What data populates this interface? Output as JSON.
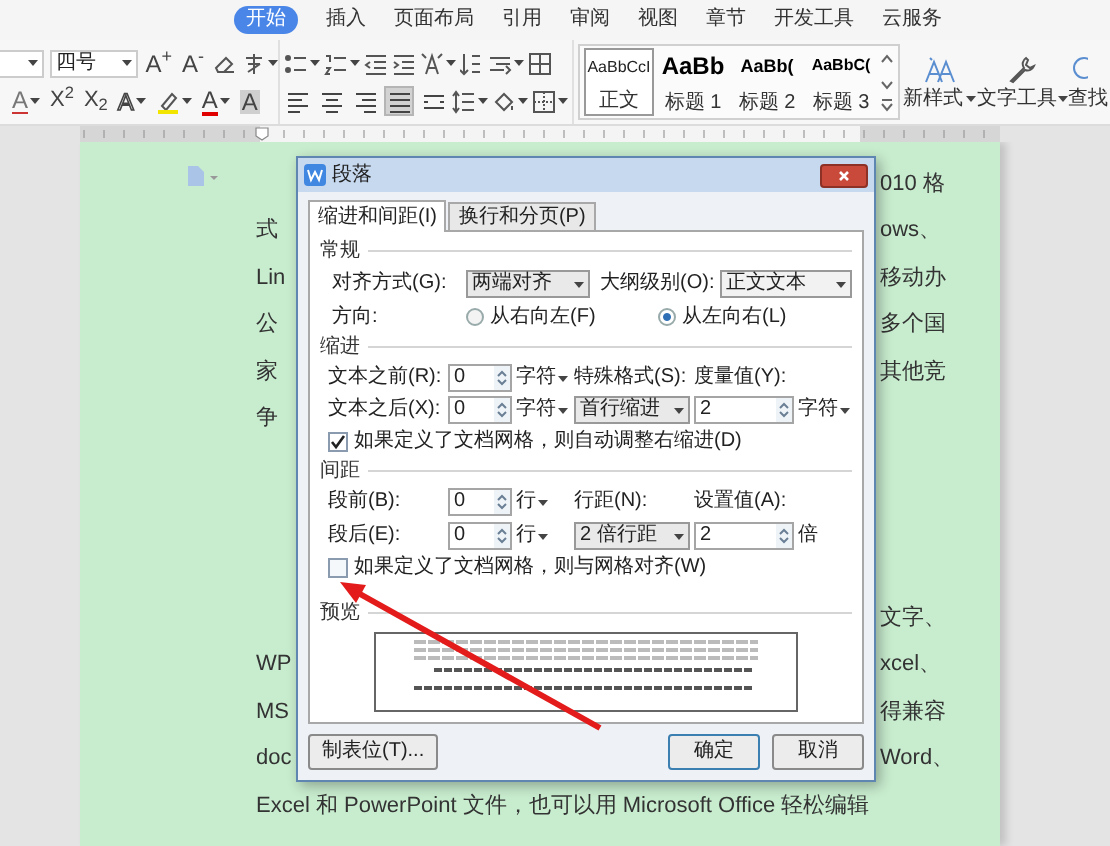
{
  "menu_tabs": [
    {
      "label": "开始",
      "selected": true
    },
    {
      "label": "插入",
      "selected": false
    },
    {
      "label": "页面布局",
      "selected": false
    },
    {
      "label": "引用",
      "selected": false
    },
    {
      "label": "审阅",
      "selected": false
    },
    {
      "label": "视图",
      "selected": false
    },
    {
      "label": "章节",
      "selected": false
    },
    {
      "label": "开发工具",
      "selected": false
    },
    {
      "label": "云服务",
      "selected": false
    }
  ],
  "ribbon": {
    "font_size": "四号",
    "font_row1": [
      "A$^{+}$",
      "A$^{-}$"
    ],
    "font_row2": [
      {
        "kind": "strike",
        "glyph": "A"
      },
      {
        "kind": "plain",
        "glyph": "X$^{2}$"
      },
      {
        "kind": "plain",
        "glyph": "X$_{2}$"
      },
      {
        "kind": "outline",
        "glyph": "A"
      },
      {
        "kind": "highlighter"
      },
      {
        "kind": "color",
        "glyph": "A"
      },
      {
        "kind": "shaded",
        "glyph": "A"
      }
    ],
    "align_buttons": [
      {
        "kind": "left",
        "selected": false
      },
      {
        "kind": "center",
        "selected": false
      },
      {
        "kind": "right",
        "selected": false
      },
      {
        "kind": "justify",
        "selected": true
      },
      {
        "kind": "distributed",
        "selected": false
      }
    ],
    "styles": [
      {
        "kind": "body",
        "sample": "AaBbCcI",
        "label": "正文",
        "selected": true
      },
      {
        "kind": "h1",
        "sample": "AaBb",
        "label": "标题 1",
        "selected": false
      },
      {
        "kind": "h2",
        "sample": "AaBb(",
        "label": "标题 2",
        "selected": false
      },
      {
        "kind": "h3",
        "sample": "AaBbC(",
        "label": "标题 3",
        "selected": false
      }
    ],
    "new_style": "新样式",
    "text_tools": "文字工具",
    "find": "查找"
  },
  "document": {
    "paragraphs": [
      {
        "lines": [
          {
            "kind": "split",
            "right": "010 格"
          },
          {
            "kind": "split",
            "left": "式",
            "right": "ows、"
          },
          {
            "kind": "split",
            "left": "Lin",
            "right": "移动办"
          },
          {
            "kind": "split",
            "left": "公",
            "right": "多个国"
          },
          {
            "kind": "split",
            "left": "家",
            "right": "其他竞"
          },
          {
            "kind": "split",
            "left": "争"
          }
        ]
      },
      {
        "lines": [
          {
            "kind": "split",
            "right": "文字、"
          },
          {
            "kind": "split",
            "left": "WP",
            "right": "xcel、"
          },
          {
            "kind": "split",
            "left": "MS",
            "right": "得兼容"
          },
          {
            "kind": "split",
            "left": "doc",
            "right": "Word、"
          },
          {
            "kind": "full",
            "text": "Excel 和 PowerPoint 文件，也可以用 Microsoft Office 轻松编辑"
          }
        ]
      }
    ]
  },
  "dialog": {
    "title": "段落",
    "tabs": [
      {
        "label": "缩进和间距(I)",
        "selected": true
      },
      {
        "label": "换行和分页(P)",
        "selected": false
      }
    ],
    "general": {
      "heading": "常规",
      "alignment_label": "对齐方式(G):",
      "alignment": "两端对齐",
      "outline_label": "大纲级别(O):",
      "outline": "正文文本",
      "direction_label": "方向:",
      "directions": [
        {
          "label": "从右向左(F)",
          "selected": false
        },
        {
          "label": "从左向右(L)",
          "selected": true
        }
      ]
    },
    "indent": {
      "heading": "缩进",
      "before_label": "文本之前(R):",
      "before": "0",
      "before_unit": "字符",
      "special_label": "特殊格式(S):",
      "measure_label": "度量值(Y):",
      "after_label": "文本之后(X):",
      "after": "0",
      "after_unit": "字符",
      "special": "首行缩进",
      "measure": "2",
      "measure_unit": "字符",
      "auto_adjust": {
        "label": "如果定义了文档网格，则自动调整右缩进(D)",
        "checked": true
      }
    },
    "spacing": {
      "heading": "间距",
      "before_label": "段前(B):",
      "before": "0",
      "before_unit": "行",
      "line_label": "行距(N):",
      "value_label": "设置值(A):",
      "after_label": "段后(E):",
      "after": "0",
      "after_unit": "行",
      "line": "2 倍行距",
      "value": "2",
      "value_unit": "倍",
      "snap": {
        "label": "如果定义了文档网格，则与网格对齐(W)",
        "checked": false
      }
    },
    "preview": {
      "heading": "预览"
    },
    "buttons": [
      {
        "kind": "tabs",
        "label": "制表位(T)..."
      },
      {
        "kind": "default",
        "label": "确定"
      },
      {
        "kind": "normal",
        "label": "取消"
      }
    ]
  }
}
